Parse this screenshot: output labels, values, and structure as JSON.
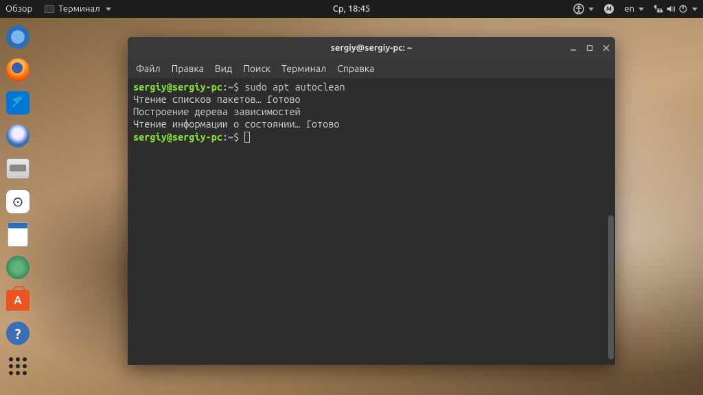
{
  "topbar": {
    "activities": "Обзор",
    "app_label": "Терминал",
    "clock": "Ср, 18:45",
    "lang": "en"
  },
  "terminal": {
    "title": "sergiy@sergiy-pc: ~",
    "menu": {
      "file": "Файл",
      "edit": "Правка",
      "view": "Вид",
      "search": "Поиск",
      "terminal": "Терминал",
      "help": "Справка"
    },
    "prompt": {
      "user_host": "sergiy@sergiy-pc",
      "sep": ":",
      "path": "~",
      "symbol": "$"
    },
    "lines": {
      "cmd1": " sudo apt autoclean",
      "out1": "Чтение списков пакетов… Готово",
      "out2": "Построение дерева зависимостей",
      "out3": "Чтение информации о состоянии… Готово"
    }
  }
}
